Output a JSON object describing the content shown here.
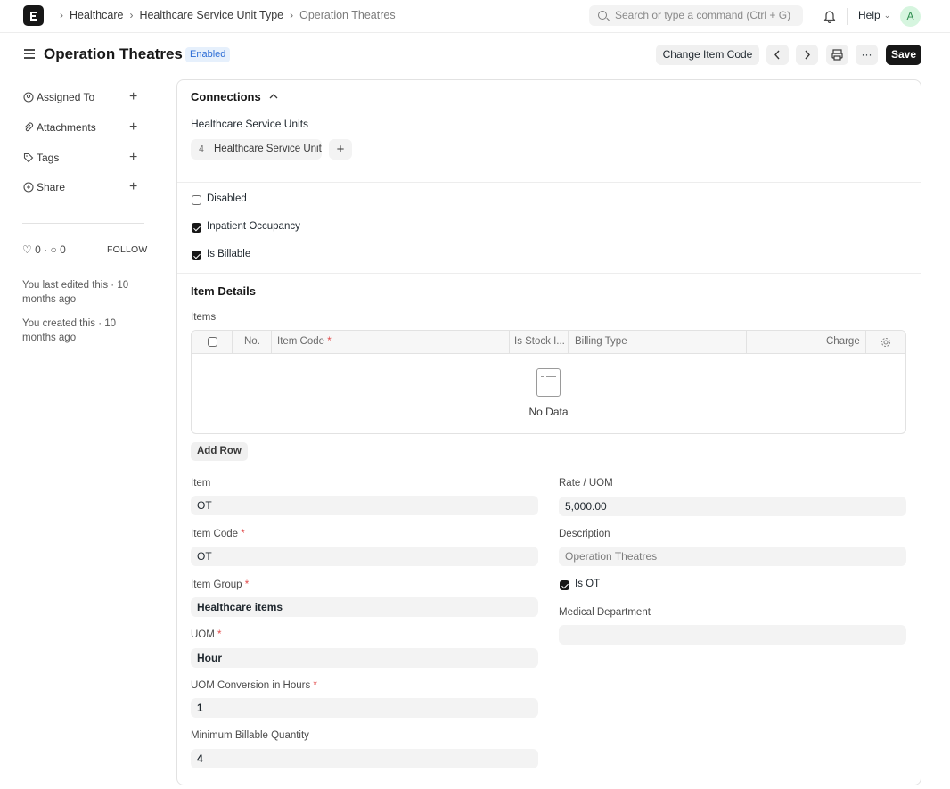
{
  "navbar": {
    "breadcrumbs": [
      "Healthcare",
      "Healthcare Service Unit Type",
      "Operation Theatres"
    ],
    "search_placeholder": "Search or type a command (Ctrl + G)",
    "help_label": "Help",
    "avatar_initial": "A"
  },
  "page": {
    "title": "Operation Theatres",
    "status": "Enabled",
    "change_item_code_label": "Change Item Code",
    "more_label": "···",
    "save_label": "Save"
  },
  "sidebar": {
    "items": [
      {
        "label": "Assigned To",
        "icon": "user-plus-icon"
      },
      {
        "label": "Attachments",
        "icon": "paperclip-icon"
      },
      {
        "label": "Tags",
        "icon": "tag-icon"
      },
      {
        "label": "Share",
        "icon": "share-icon"
      }
    ],
    "likes": "0",
    "comments": "0",
    "follow_label": "FOLLOW",
    "last_edited": "You last edited this · 10 months ago",
    "created": "You created this · 10 months ago"
  },
  "connections": {
    "title": "Connections",
    "group_label": "Healthcare Service Units",
    "link_count": "4",
    "link_label": "Healthcare Service Unit"
  },
  "checks": [
    {
      "label": "Disabled",
      "checked": false
    },
    {
      "label": "Inpatient Occupancy",
      "checked": true
    },
    {
      "label": "Is Billable",
      "checked": true
    }
  ],
  "item_details": {
    "title": "Item Details",
    "items_label": "Items",
    "columns": [
      "No.",
      "Item Code",
      "Is Stock I...",
      "Billing Type",
      "Charge"
    ],
    "empty_text": "No Data",
    "add_row_label": "Add Row"
  },
  "fields": {
    "item": {
      "label": "Item",
      "value": "OT"
    },
    "item_code": {
      "label": "Item Code",
      "value": "OT"
    },
    "item_group": {
      "label": "Item Group",
      "value": "Healthcare items"
    },
    "uom": {
      "label": "UOM",
      "value": "Hour"
    },
    "uom_conversion": {
      "label": "UOM Conversion in Hours",
      "value": "1"
    },
    "min_billable_qty": {
      "label": "Minimum Billable Quantity",
      "value": "4"
    },
    "rate": {
      "label": "Rate / UOM",
      "value": "5,000.00"
    },
    "description": {
      "label": "Description",
      "value": "Operation Theatres"
    },
    "is_ot": {
      "label": "Is OT",
      "checked": true
    },
    "medical_department": {
      "label": "Medical Department",
      "value": ""
    }
  }
}
